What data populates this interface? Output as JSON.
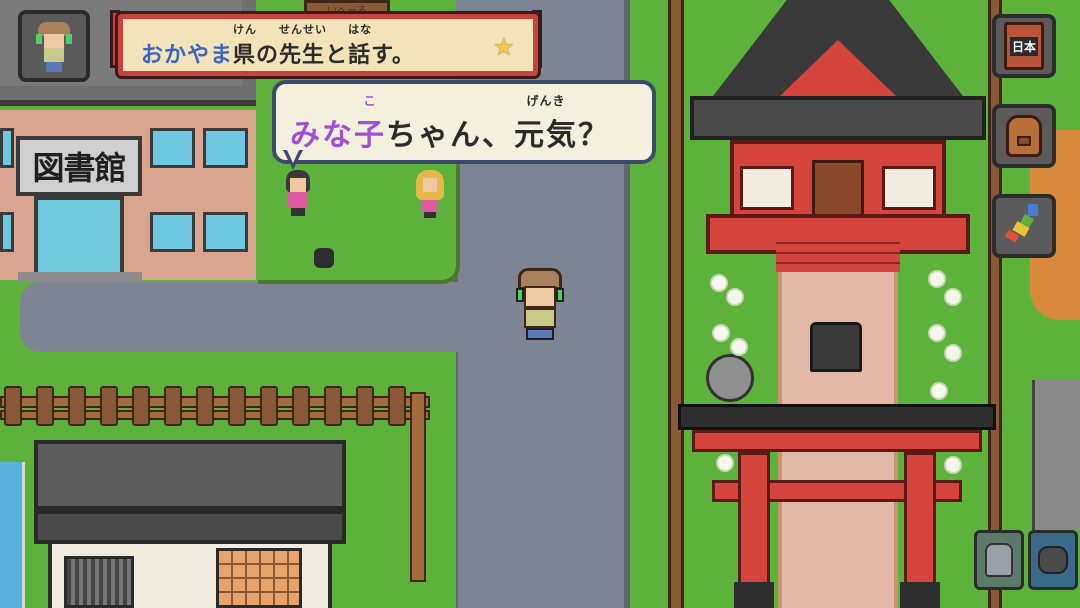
{
  "quest": {
    "prefecture": "おかやま",
    "text_ken": "県",
    "ruby_ken": "けん",
    "text_no": "の",
    "text_sensei": "先生",
    "ruby_sensei": "せんせい",
    "text_to": "と",
    "text_hana": "話",
    "ruby_hana": "はな",
    "text_end": "す。",
    "star_icon": "star-icon",
    "colors": {
      "prefecture": "#3b64c4",
      "text": "#2b2b2b"
    }
  },
  "dialog": {
    "name_part": "みな",
    "name_kanji": "子",
    "ruby_name": "こ",
    "after_name": "ちゃん、",
    "genki": "元気",
    "ruby_genki": "げんき",
    "end": "？",
    "colors": {
      "name": "#a24fd6",
      "text": "#2b2b2b"
    }
  },
  "library": {
    "sign": "図書館"
  },
  "sidebar": {
    "dictionary_label": "日本",
    "items": [
      "book-icon",
      "backpack-icon",
      "japan-map-icon"
    ]
  },
  "bottom_bar": {
    "items": [
      "cat-icon",
      "dog-icon"
    ]
  },
  "signboard": {
    "text": "いへーる"
  }
}
